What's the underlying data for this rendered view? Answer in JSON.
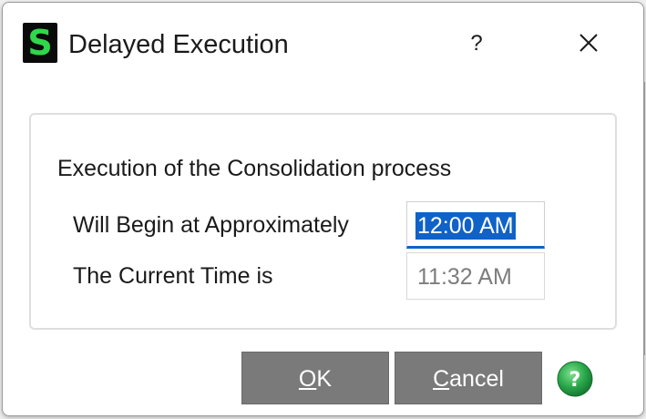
{
  "window": {
    "title": "Delayed Execution",
    "app_icon_glyph": "S",
    "help_label": "?",
    "close_icon": "close-icon"
  },
  "content": {
    "heading": "Execution of the Consolidation process",
    "begin_label": "Will Begin at Approximately",
    "begin_time": "12:00 AM",
    "current_label": "The Current Time is",
    "current_time": "11:32 AM"
  },
  "buttons": {
    "ok_accel": "O",
    "ok_rest": "K",
    "cancel_accel": "C",
    "cancel_rest": "ancel",
    "help_icon": "help-circle-icon"
  },
  "colors": {
    "accent": "#0f62c8",
    "button_bg": "#7a7a7a",
    "icon_green": "#2fd84a",
    "help_green": "#2aa84a"
  }
}
